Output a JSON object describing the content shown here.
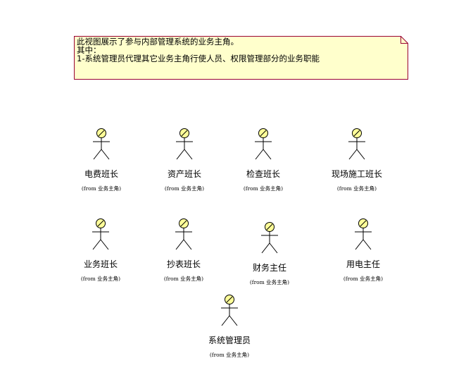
{
  "note": {
    "lines": [
      "此视图展示了参与内部管理系统的业务主角。",
      "其中：",
      "1-系统管理员代理其它业务主角行使人员、权限管理部分的业务职能"
    ]
  },
  "actors": [
    {
      "name": "电费班长",
      "from": "(from 业务主角)"
    },
    {
      "name": "资产班长",
      "from": "(from 业务主角)"
    },
    {
      "name": "检查班长",
      "from": "(from 业务主角)"
    },
    {
      "name": "现场施工班长",
      "from": "(from 业务主角)"
    },
    {
      "name": "业务班长",
      "from": "(from 业务主角)"
    },
    {
      "name": "抄表班长",
      "from": "(from 业务主角)"
    },
    {
      "name": "财务主任",
      "from": "(from 业务主角)"
    },
    {
      "name": "用电主任",
      "from": "(from 业务主角)"
    },
    {
      "name": "系统管理员",
      "from": "(from 业务主角)"
    }
  ],
  "colors": {
    "note_fill": "#ffffcc",
    "note_border": "#990033",
    "actor_head": "#ffff99",
    "line": "#000000"
  }
}
